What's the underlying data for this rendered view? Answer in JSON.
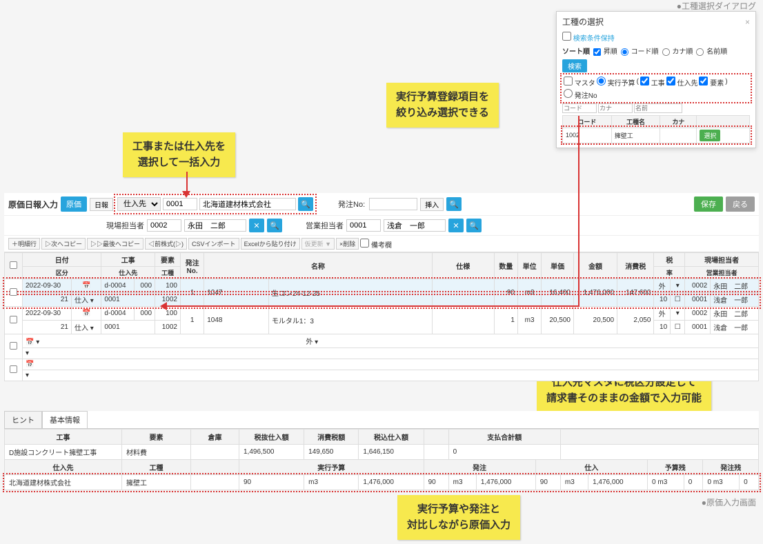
{
  "labels": {
    "dialog_caption": "●工種選択ダイアログ",
    "main_caption": "●原価入力画面"
  },
  "callouts": {
    "c1_l1": "実行予算登録項目を",
    "c1_l2": "絞り込み選択できる",
    "c2_l1": "工事または仕入先を",
    "c2_l2": "選択して一括入力",
    "c3_l1": "仕入先マスタに税区分設定して",
    "c3_l2": "請求書そのままの金額で入力可能",
    "c4_l1": "実行予算や発注と",
    "c4_l2": "対比しながら原価入力"
  },
  "dialog": {
    "title": "工種の選択",
    "keep_cond": "検索条件保持",
    "sort_label": "ソート順",
    "ascending": "昇順",
    "code_order": "コード順",
    "kana_order": "カナ順",
    "name_order": "名前順",
    "search_btn": "検索",
    "master": "マスタ",
    "exec_budget": "実行予算",
    "construction": "工事",
    "supplier": "仕入先",
    "element": "要素",
    "order_no": "発注No",
    "col_code": "コード",
    "col_kana": "カナ",
    "col_name": "名前",
    "hdr_code": "コード",
    "hdr_type": "工種名",
    "hdr_kana": "カナ",
    "row_code": "1002",
    "row_name": "擁壁工",
    "select_btn": "選択"
  },
  "toolbar": {
    "title": "原価日報入力",
    "btn_cost": "原価",
    "btn_daily": "日報",
    "select_supplier": "仕入先",
    "code1": "0001",
    "company": "北海道建材株式会社",
    "order_no_label": "発注No:",
    "insert_btn": "挿入",
    "save_btn": "保存",
    "back_btn": "戻る",
    "site_mgr_label": "現場担当者",
    "site_mgr_code": "0002",
    "site_mgr_name": "永田　二郎",
    "sales_mgr_label": "営業担当者",
    "sales_mgr_code": "0001",
    "sales_mgr_name": "浅倉　一郎"
  },
  "actions": {
    "add_row": "＋明細行",
    "copy_next": "▷次へコピー",
    "copy_last": "▷▷最後へコピー",
    "del_first": "◁前株式(▷)",
    "csv": "CSVインポート",
    "excel": "Excelから貼り付け",
    "refresh": "仮更新 ▼",
    "delete": "×削除",
    "remarks": "備考欄"
  },
  "grid": {
    "hdr_date": "日付",
    "hdr_work": "工事",
    "hdr_elem": "要素",
    "hdr_order": "発注",
    "hdr_orderno": "No.",
    "hdr_name": "名称",
    "hdr_spec": "仕様",
    "hdr_qty": "数量",
    "hdr_unit": "単位",
    "hdr_price": "単価",
    "hdr_amount": "金額",
    "hdr_tax": "消費税",
    "hdr_taxcat": "税",
    "hdr_rate": "率",
    "hdr_site": "現場担当者",
    "hdr_sales": "営業担当者",
    "sub_class": "区分",
    "sub_supplier": "仕入先",
    "sub_type": "工種",
    "rows": [
      {
        "date": "2022-09-30",
        "work": "d-0004",
        "elem": "000",
        "elem2": "100",
        "class": "21",
        "class_name": "仕入",
        "supplier": "0001",
        "type": "1002",
        "order_no": "1",
        "name_code": "1047",
        "name": "生コン24-12-25",
        "qty": "90",
        "unit": "m3",
        "price": "16,400",
        "amount": "1,476,000",
        "tax": "147,600",
        "tax_cat": "外",
        "rate": "10",
        "site_code": "0002",
        "site_name": "永田　二郎",
        "sales_code": "0001",
        "sales_name": "浅倉　一郎"
      },
      {
        "date": "2022-09-30",
        "work": "d-0004",
        "elem": "000",
        "elem2": "100",
        "class": "21",
        "class_name": "仕入",
        "supplier": "0001",
        "type": "1002",
        "order_no": "1",
        "name_code": "1048",
        "name": "モルタル1：3",
        "qty": "1",
        "unit": "m3",
        "price": "20,500",
        "amount": "20,500",
        "tax": "2,050",
        "tax_cat": "外",
        "rate": "10",
        "site_code": "0002",
        "site_name": "永田　二郎",
        "sales_code": "0001",
        "sales_name": "浅倉　一郎"
      }
    ]
  },
  "tabs": {
    "hint": "ヒント",
    "basic": "基本情報"
  },
  "info": {
    "col_work": "工事",
    "col_elem": "要素",
    "col_store": "倉庫",
    "col_notax": "税抜仕入額",
    "col_taxamt": "消費税額",
    "col_withtax": "税込仕入額",
    "col_paytotal": "支払合計額",
    "work_name": "D施設コンクリート擁壁工事",
    "elem_name": "材料費",
    "notax": "1,496,500",
    "taxamt": "149,650",
    "withtax": "1,646,150",
    "paytotal": "0",
    "col_supplier": "仕入先",
    "col_worktype": "工種",
    "col_budget": "実行予算",
    "col_order": "発注",
    "col_purchase": "仕入",
    "col_budget_rem": "予算残",
    "col_order_rem": "発注残",
    "supplier_name": "北海道建材株式会社",
    "worktype_name": "擁壁工",
    "budget_qty": "90",
    "budget_unit": "m3",
    "budget_amt": "1,476,000",
    "order_qty": "90",
    "order_unit": "m3",
    "order_amt": "1,476,000",
    "purchase_qty": "90",
    "purchase_unit": "m3",
    "purchase_amt": "1,476,000",
    "budget_rem_qty": "0",
    "budget_rem_unit": "m3",
    "budget_rem_amt": "0",
    "order_rem_qty": "0",
    "order_rem_unit": "m3",
    "order_rem_amt": "0"
  }
}
